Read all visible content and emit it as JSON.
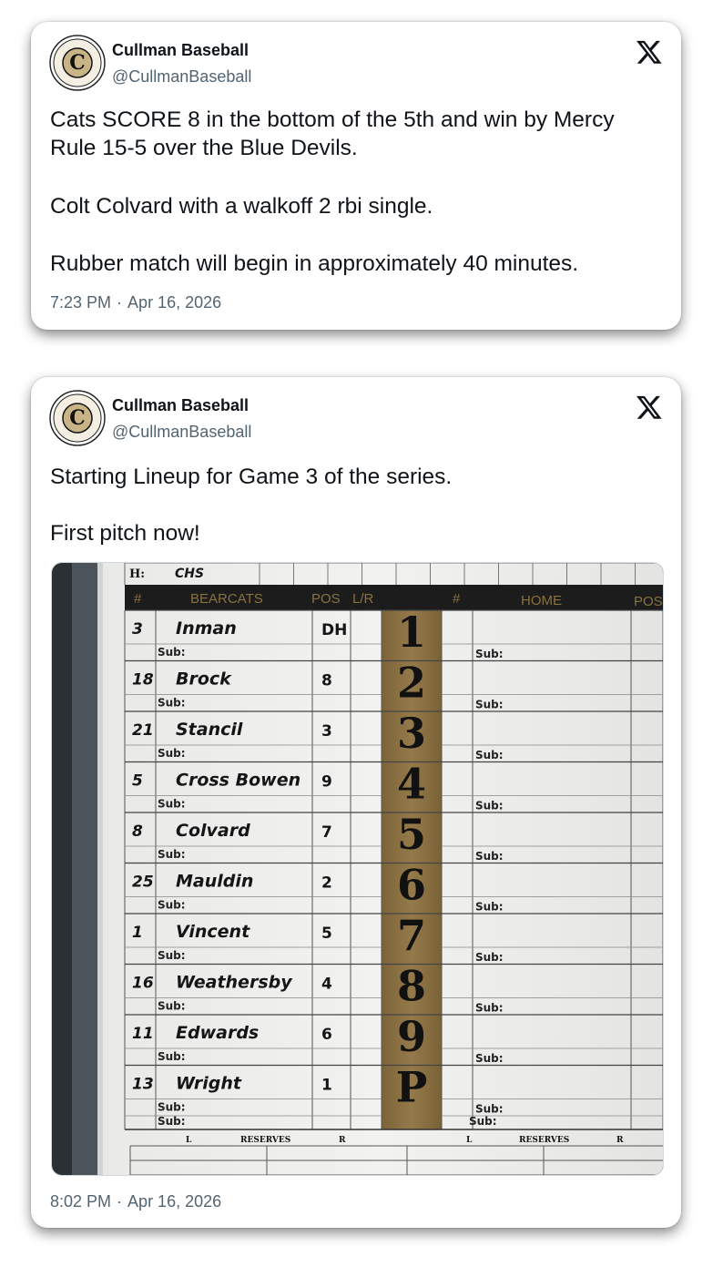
{
  "tweets": [
    {
      "author_name": "Cullman Baseball",
      "author_handle": "@CullmanBaseball",
      "avatar": {
        "letter": "C",
        "ring_top": "CULLMAN HIGH SCHOOL",
        "ring_bottom": "BASEBALL"
      },
      "paragraphs": [
        "Cats SCORE 8 in the bottom of the 5th and win by Mercy Rule 15-5 over the Blue Devils.",
        "Colt Colvard with a walkoff 2 rbi single.",
        "Rubber match will begin in approximately 40 minutes."
      ],
      "time": "7:23 PM",
      "date": "Apr 16, 2026"
    },
    {
      "author_name": "Cullman Baseball",
      "author_handle": "@CullmanBaseball",
      "avatar": {
        "letter": "C",
        "ring_top": "CULLMAN HIGH SCHOOL",
        "ring_bottom": "BASEBALL"
      },
      "paragraphs": [
        "Starting Lineup for Game 3 of the series.",
        "First pitch now!"
      ],
      "time": "8:02 PM",
      "date": "Apr 16, 2026"
    }
  ],
  "lineup_card": {
    "top_label": "H:",
    "top_value": "CHS",
    "headers": {
      "num": "#",
      "team": "BEARCATS",
      "pos": "POS",
      "lr": "L/R",
      "home_num": "#",
      "home": "HOME",
      "home_pos": "POS"
    },
    "sub_label": "Sub:",
    "players": [
      {
        "num": "3",
        "name": "Inman",
        "pos": "DH",
        "order": "1"
      },
      {
        "num": "18",
        "name": "Brock",
        "pos": "8",
        "order": "2"
      },
      {
        "num": "21",
        "name": "Stancil",
        "pos": "3",
        "order": "3"
      },
      {
        "num": "5",
        "name": "Cross Bowen",
        "pos": "9",
        "order": "4"
      },
      {
        "num": "8",
        "name": "Colvard",
        "pos": "7",
        "order": "5"
      },
      {
        "num": "25",
        "name": "Mauldin",
        "pos": "2",
        "order": "6"
      },
      {
        "num": "1",
        "name": "Vincent",
        "pos": "5",
        "order": "7"
      },
      {
        "num": "16",
        "name": "Weathersby",
        "pos": "4",
        "order": "8"
      },
      {
        "num": "11",
        "name": "Edwards",
        "pos": "6",
        "order": "9"
      },
      {
        "num": "13",
        "name": "Wright",
        "pos": "1",
        "order": "P"
      }
    ],
    "reserves": {
      "left": "L",
      "label": "RESERVES",
      "right": "R"
    }
  },
  "colors": {
    "text": "#0f1419",
    "secondary": "#536471",
    "gold": "#8a7140",
    "header_bar": "#1c1c1c",
    "ink": "#151515"
  }
}
